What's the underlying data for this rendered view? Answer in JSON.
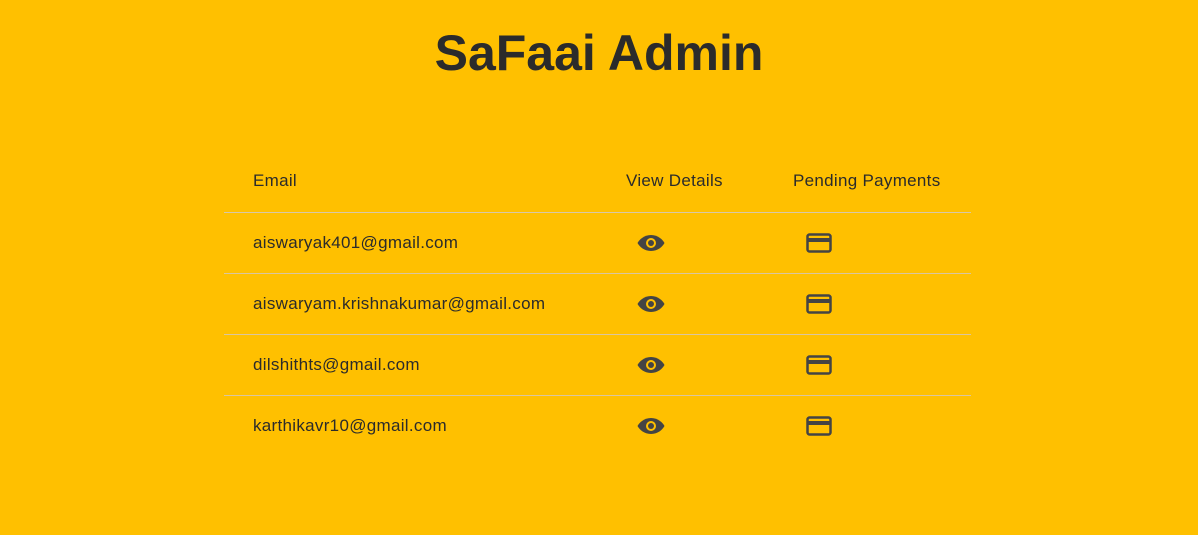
{
  "app": {
    "title": "SaFaai Admin"
  },
  "table": {
    "headers": {
      "email": "Email",
      "view_details": "View Details",
      "pending_payments": "Pending Payments"
    },
    "rows": [
      {
        "email": "aiswaryak401@gmail.com",
        "view_icon": "eye-icon",
        "payment_icon": "credit-card-icon"
      },
      {
        "email": "aiswaryam.krishnakumar@gmail.com",
        "view_icon": "eye-icon",
        "payment_icon": "credit-card-icon"
      },
      {
        "email": "dilshithts@gmail.com",
        "view_icon": "eye-icon",
        "payment_icon": "credit-card-icon"
      },
      {
        "email": "karthikavr10@gmail.com",
        "view_icon": "eye-icon",
        "payment_icon": "credit-card-icon"
      }
    ]
  },
  "colors": {
    "background": "#FFC000",
    "text": "#2b2b2b",
    "icon": "#444444",
    "divider": "#d9c6a0"
  }
}
